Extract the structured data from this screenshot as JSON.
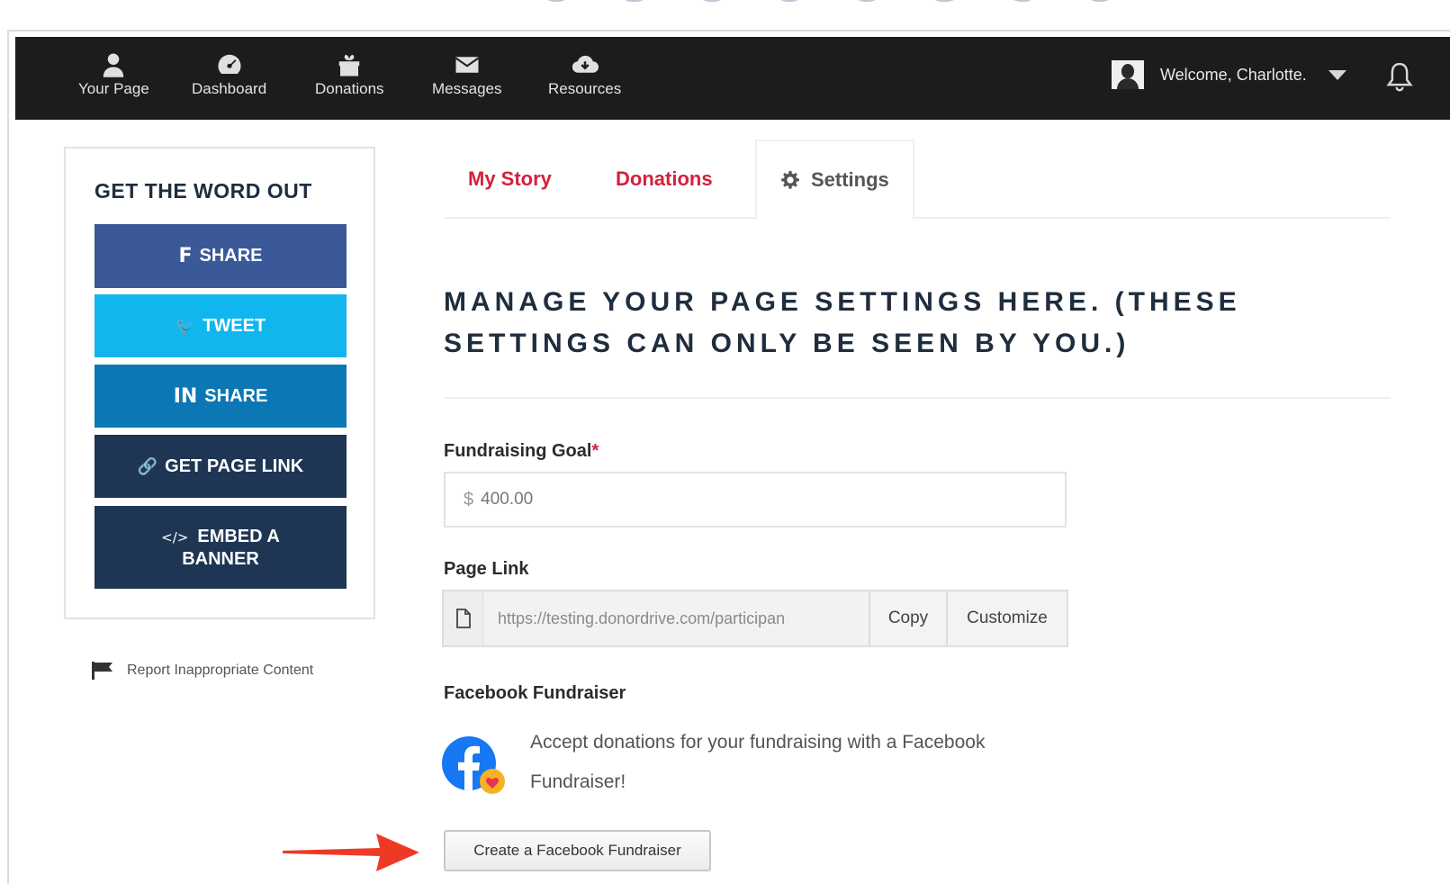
{
  "nav": {
    "items": [
      {
        "label": "Your Page",
        "icon": "user-icon"
      },
      {
        "label": "Dashboard",
        "icon": "dashboard-icon"
      },
      {
        "label": "Donations",
        "icon": "gift-icon"
      },
      {
        "label": "Messages",
        "icon": "envelope-icon"
      },
      {
        "label": "Resources",
        "icon": "cloud-download-icon"
      }
    ],
    "welcome": "Welcome, Charlotte.",
    "bell_icon": "bell-icon"
  },
  "sidebar": {
    "title": "GET THE WORD OUT",
    "buttons": [
      {
        "icon_text": "f",
        "label": "SHARE",
        "color": "#3b5998"
      },
      {
        "icon_text": "🐦",
        "label": "TWEET",
        "color": "#12b6ee"
      },
      {
        "icon_text": "in",
        "label": "SHARE",
        "color": "#0b78b5"
      },
      {
        "icon_text": "🔗",
        "label": "GET PAGE LINK",
        "color": "#1e3654"
      },
      {
        "icon_text": "</>",
        "label": "EMBED A BANNER",
        "color": "#1e3654"
      }
    ],
    "report_label": "Report Inappropriate Content"
  },
  "tabs": [
    {
      "label": "My Story"
    },
    {
      "label": "Donations"
    },
    {
      "label": "Settings"
    }
  ],
  "main": {
    "heading": "MANAGE YOUR PAGE SETTINGS HERE. (THESE SETTINGS CAN ONLY BE SEEN BY YOU.)",
    "goal_label": "Fundraising Goal",
    "goal_required": "*",
    "goal_currency": "$",
    "goal_value": "400.00",
    "link_label": "Page Link",
    "link_value": "https://testing.donordrive.com/participan",
    "copy_label": "Copy",
    "customize_label": "Customize",
    "fb_label": "Facebook Fundraiser",
    "fb_text": "Accept donations for your fundraising with a Facebook Fundraiser!",
    "fb_button": "Create a Facebook Fundraiser"
  },
  "colors": {
    "accent_red": "#d4213d",
    "nav_bg": "#1c1c1c",
    "heading_navy": "#1f2d3d"
  }
}
